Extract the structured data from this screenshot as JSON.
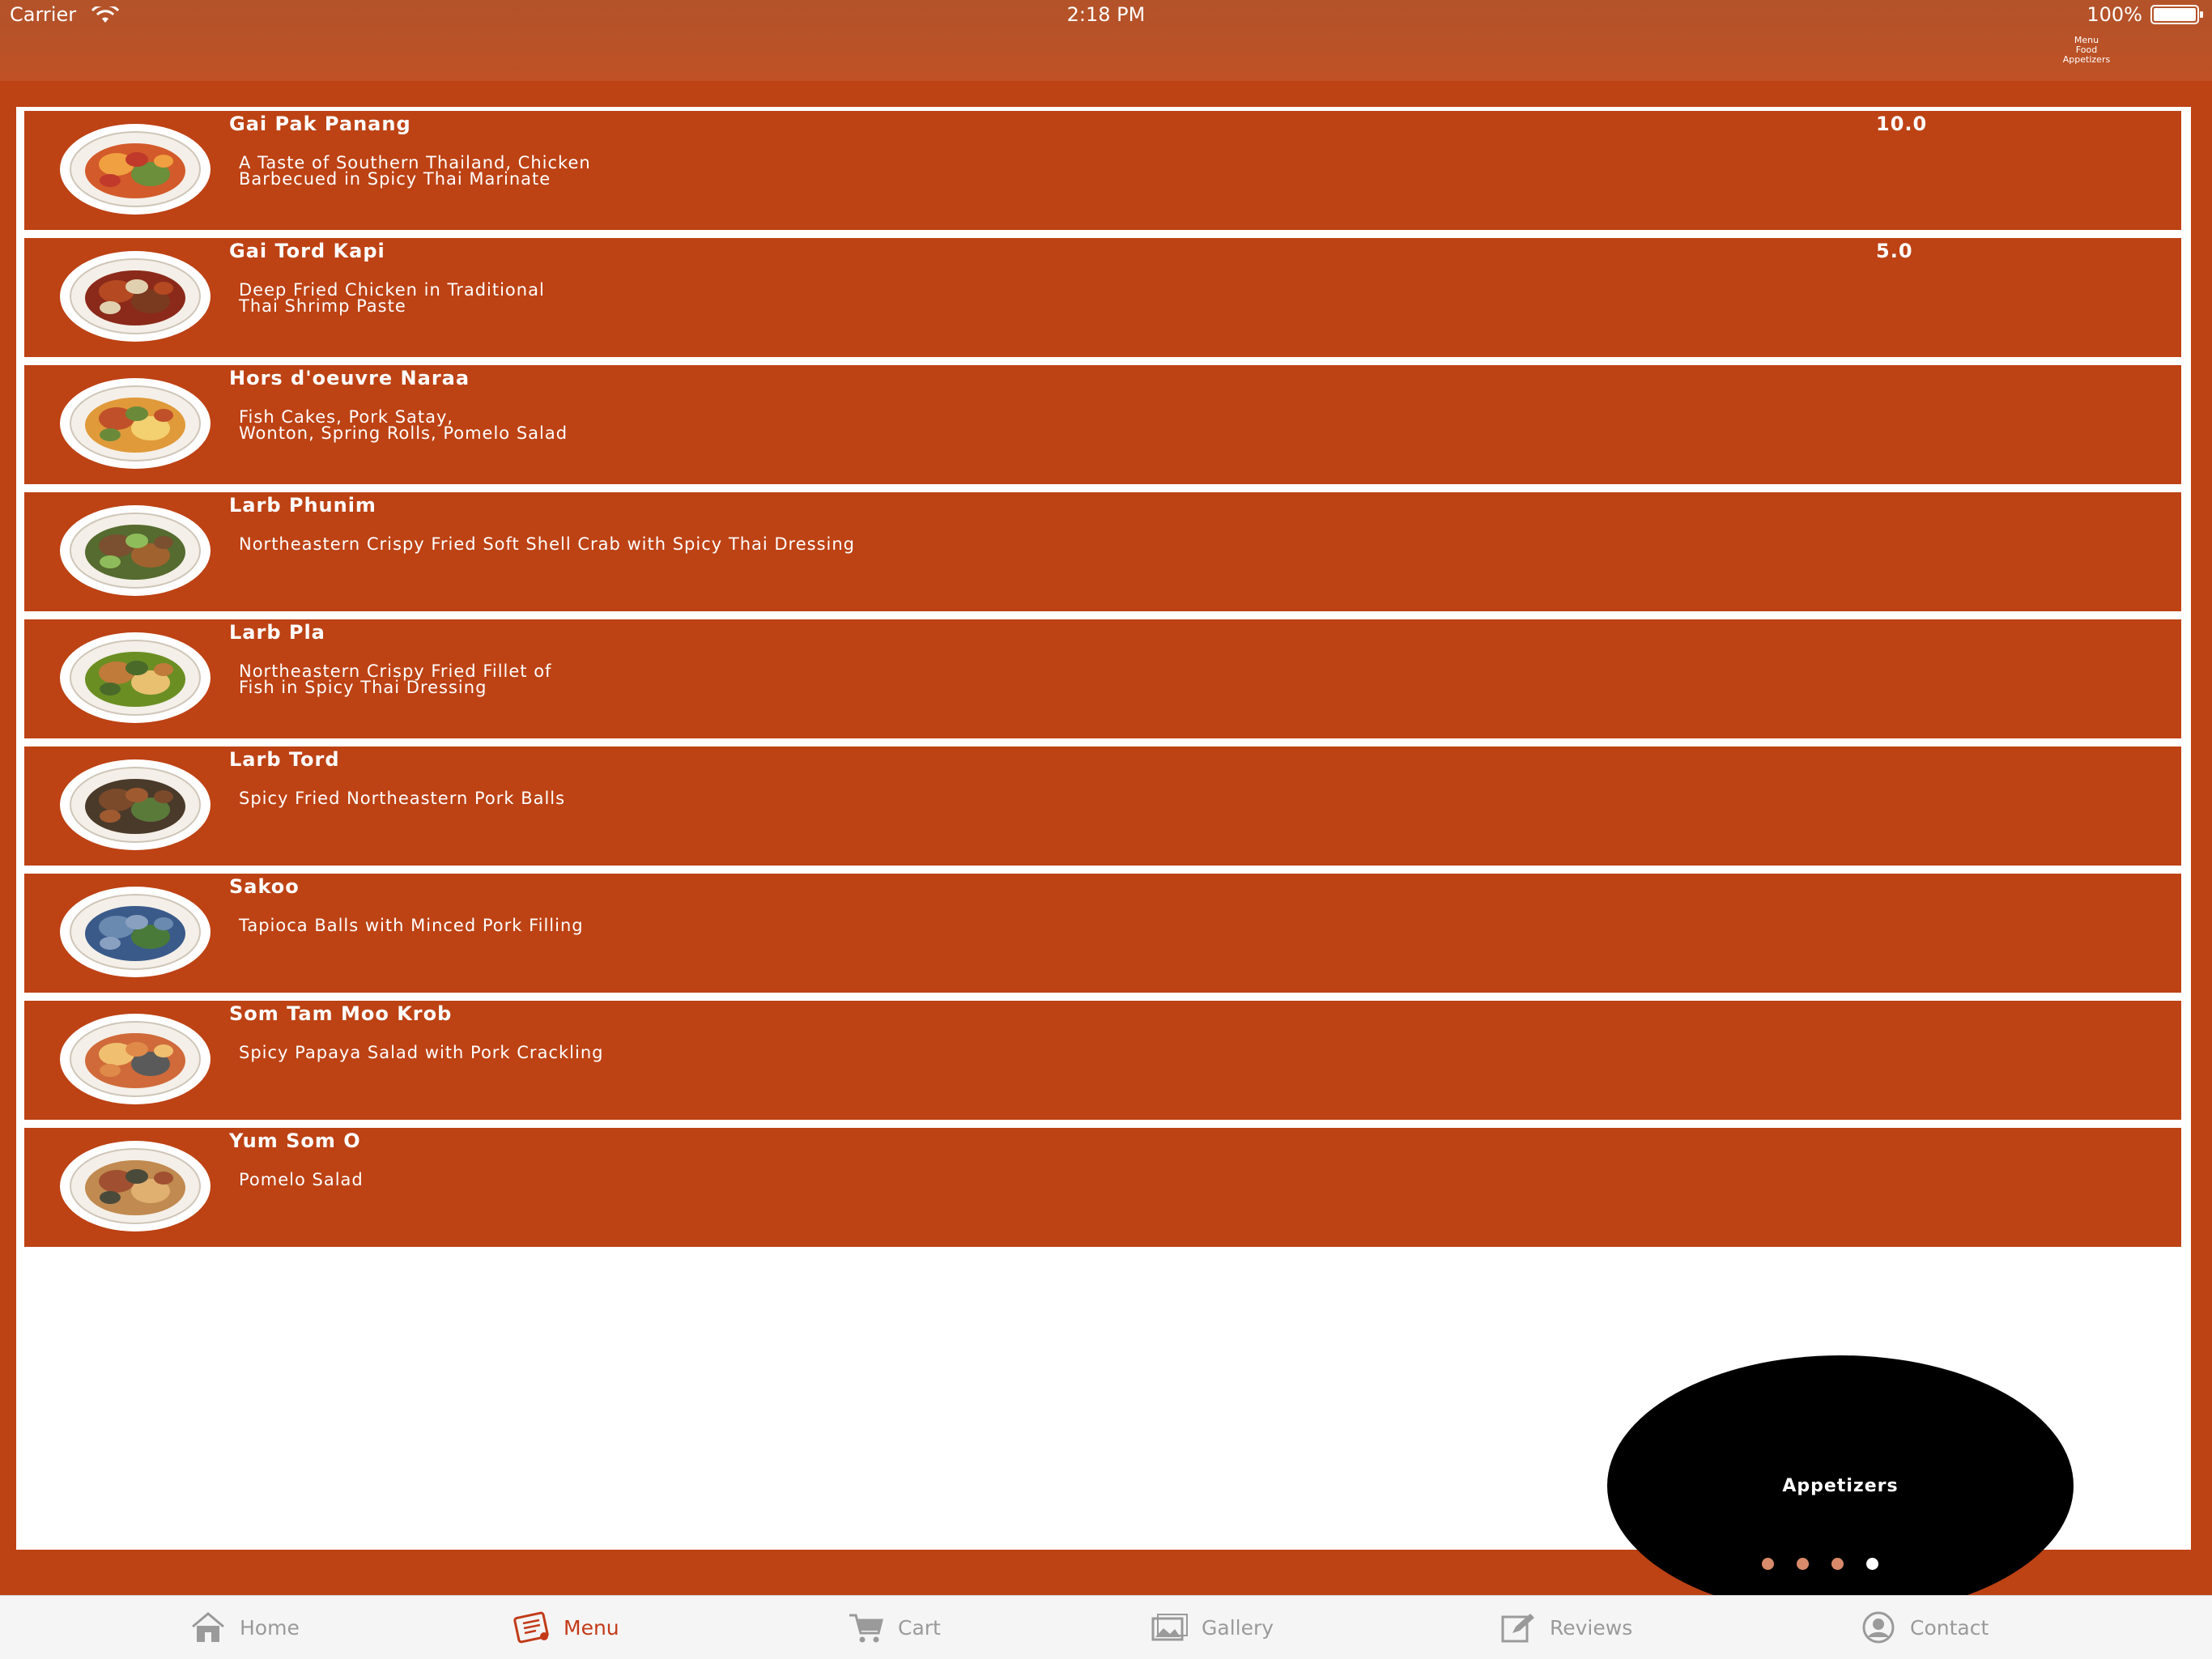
{
  "status_bar": {
    "carrier": "Carrier",
    "time": "2:18 PM",
    "battery": "100%"
  },
  "breadcrumb": [
    "Menu",
    "Food",
    "Appetizers"
  ],
  "menu_items": [
    {
      "name": "Gai Pak Panang",
      "description": "A Taste of Southern Thailand, Chicken\nBarbecued in Spicy Thai Marinate",
      "price": "10.0"
    },
    {
      "name": "Gai Tord Kapi",
      "description": "Deep Fried Chicken in Traditional\nThai Shrimp Paste",
      "price": "5.0"
    },
    {
      "name": "Hors d'oeuvre Naraa",
      "description": "Fish Cakes, Pork Satay,\nWonton, Spring Rolls, Pomelo Salad",
      "price": ""
    },
    {
      "name": "Larb Phunim",
      "description": "Northeastern Crispy Fried Soft Shell Crab with Spicy Thai Dressing",
      "price": ""
    },
    {
      "name": "Larb Pla",
      "description": "Northeastern Crispy Fried Fillet of\nFish in Spicy Thai Dressing",
      "price": ""
    },
    {
      "name": "Larb Tord",
      "description": "Spicy Fried Northeastern Pork Balls",
      "price": ""
    },
    {
      "name": "Sakoo",
      "description": "Tapioca Balls with Minced Pork Filling",
      "price": ""
    },
    {
      "name": "Som Tam Moo Krob",
      "description": "Spicy Papaya Salad with Pork Crackling",
      "price": ""
    },
    {
      "name": "Yum Som O",
      "description": "Pomelo Salad",
      "price": ""
    }
  ],
  "category_bubble": "Appetizers",
  "page_dots": {
    "count": 4,
    "active": 4
  },
  "tabs": [
    {
      "label": "Home",
      "icon": "home-icon",
      "active": false
    },
    {
      "label": "Menu",
      "icon": "menu-icon",
      "active": true
    },
    {
      "label": "Cart",
      "icon": "cart-icon",
      "active": false
    },
    {
      "label": "Gallery",
      "icon": "gallery-icon",
      "active": false
    },
    {
      "label": "Reviews",
      "icon": "reviews-icon",
      "active": false
    },
    {
      "label": "Contact",
      "icon": "contact-icon",
      "active": false
    }
  ],
  "colors": {
    "brand": "#bd4214",
    "active_tab": "#c23b18",
    "tab_inactive": "#9a9a9a",
    "bubble": "#000000"
  }
}
